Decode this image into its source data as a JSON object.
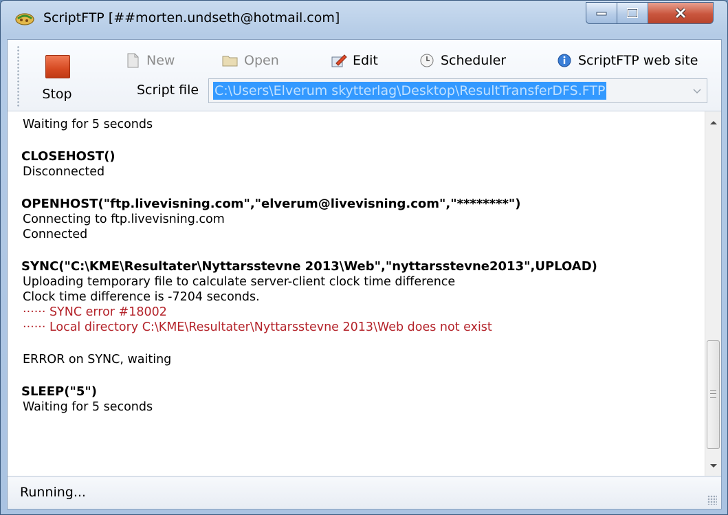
{
  "window": {
    "title": "ScriptFTP [##morten.undseth@hotmail.com]",
    "controls": {
      "minimize": "minimize",
      "maximize": "maximize",
      "close": "close"
    }
  },
  "toolbar": {
    "stop_label": "Stop",
    "new_label": "New",
    "open_label": "Open",
    "edit_label": "Edit",
    "scheduler_label": "Scheduler",
    "website_label": "ScriptFTP web site",
    "script_file_label": "Script file",
    "script_file_value": "C:\\Users\\Elverum skytterlag\\Desktop\\ResultTransferDFS.FTP"
  },
  "log": {
    "line1": "Waiting for 5 seconds",
    "cmd2": "CLOSEHOST()",
    "line2": "Disconnected",
    "cmd3": "OPENHOST(\"ftp.livevisning.com\",\"elverum@livevisning.com\",\"********\")",
    "line3a": "Connecting to ftp.livevisning.com",
    "line3b": "Connected",
    "cmd4": "SYNC(\"C:\\KME\\Resultater\\Nyttarsstevne 2013\\Web\",\"nyttarsstevne2013\",UPLOAD)",
    "line4a": "Uploading temporary file to calculate server-client clock time difference",
    "line4b": "Clock time difference is -7204 seconds.",
    "err4a": "······ SYNC error #18002",
    "err4b": "······ Local directory C:\\KME\\Resultater\\Nyttarsstevne 2013\\Web does not exist",
    "line5": "ERROR on SYNC, waiting",
    "cmd6": "SLEEP(\"5\")",
    "line6": "Waiting for 5 seconds"
  },
  "status": {
    "text": "Running..."
  },
  "icons": {
    "app": "scriptftp-app-icon",
    "stop": "stop-icon",
    "new": "new-document-icon",
    "open": "folder-icon",
    "edit": "edit-icon",
    "scheduler": "clock-icon",
    "website": "info-icon"
  }
}
